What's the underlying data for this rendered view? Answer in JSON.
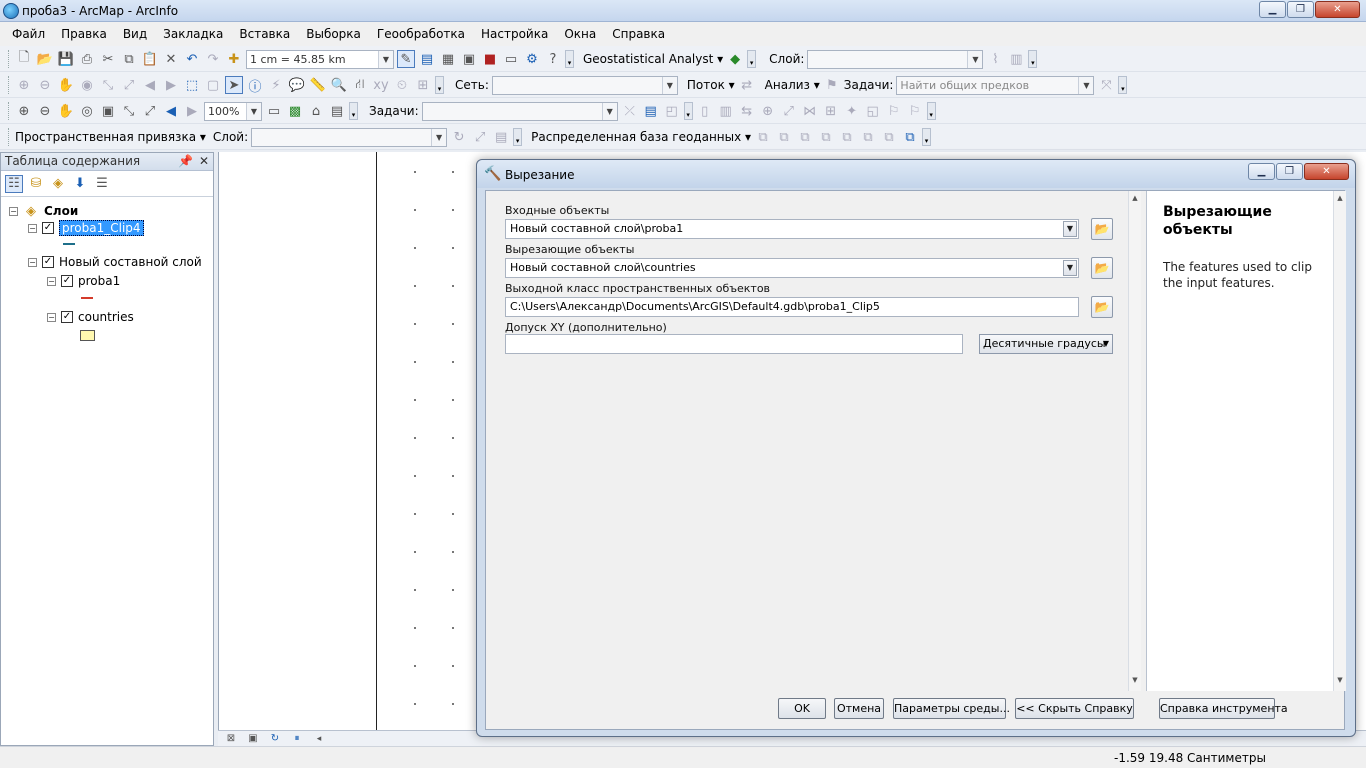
{
  "window": {
    "title": "проба3 - ArcMap - ArcInfo"
  },
  "menu": [
    "Файл",
    "Правка",
    "Вид",
    "Закладка",
    "Вставка",
    "Выборка",
    "Геообработка",
    "Настройка",
    "Окна",
    "Справка"
  ],
  "toolbar": {
    "scale": "1 cm = 45.85 km",
    "geostat_label": "Geostatistical Analyst ▾",
    "layer_label": "Слой:",
    "network_label": "Сеть:",
    "flow_label": "Поток ▾",
    "analysis_label": "Анализ ▾",
    "tasks_label": "Задачи:",
    "tasks_value": "Найти общих предков",
    "zoom_percent": "100%",
    "tasks2_label": "Задачи:",
    "spatial_snap_label": "Пространственная привязка ▾",
    "layer2_label": "Слой:",
    "distributed_db_label": "Распределенная база геоданных ▾"
  },
  "toc": {
    "title": "Таблица содержания",
    "root_label": "Слои",
    "layers": [
      {
        "label": "proba1_Clip4",
        "checked": true
      },
      {
        "label": "Новый составной слой",
        "checked": true
      },
      {
        "label": "proba1",
        "checked": true
      },
      {
        "label": "countries",
        "checked": true
      }
    ]
  },
  "dialog": {
    "title": "Вырезание",
    "params": {
      "input_label": "Входные объекты",
      "input_value": "Новый составной слой\\proba1",
      "clip_label": "Вырезающие объекты",
      "clip_value": "Новый составной слой\\countries",
      "output_label": "Выходной класс пространственных объектов",
      "output_value": "C:\\Users\\Александр\\Documents\\ArcGIS\\Default4.gdb\\proba1_Clip5",
      "tolerance_label": "Допуск XY (дополнительно)",
      "tolerance_value": "",
      "tolerance_units": "Десятичные градусы"
    },
    "help": {
      "title": "Вырезающие объекты",
      "text": "The features used to clip the input features."
    },
    "buttons": {
      "ok": "OK",
      "cancel": "Отмена",
      "env": "Параметры среды...",
      "hide_help": "<< Скрыть Справку",
      "tool_help": "Справка инструмента"
    }
  },
  "status": {
    "coords": "-1.59  19.48 Сантиметры"
  }
}
